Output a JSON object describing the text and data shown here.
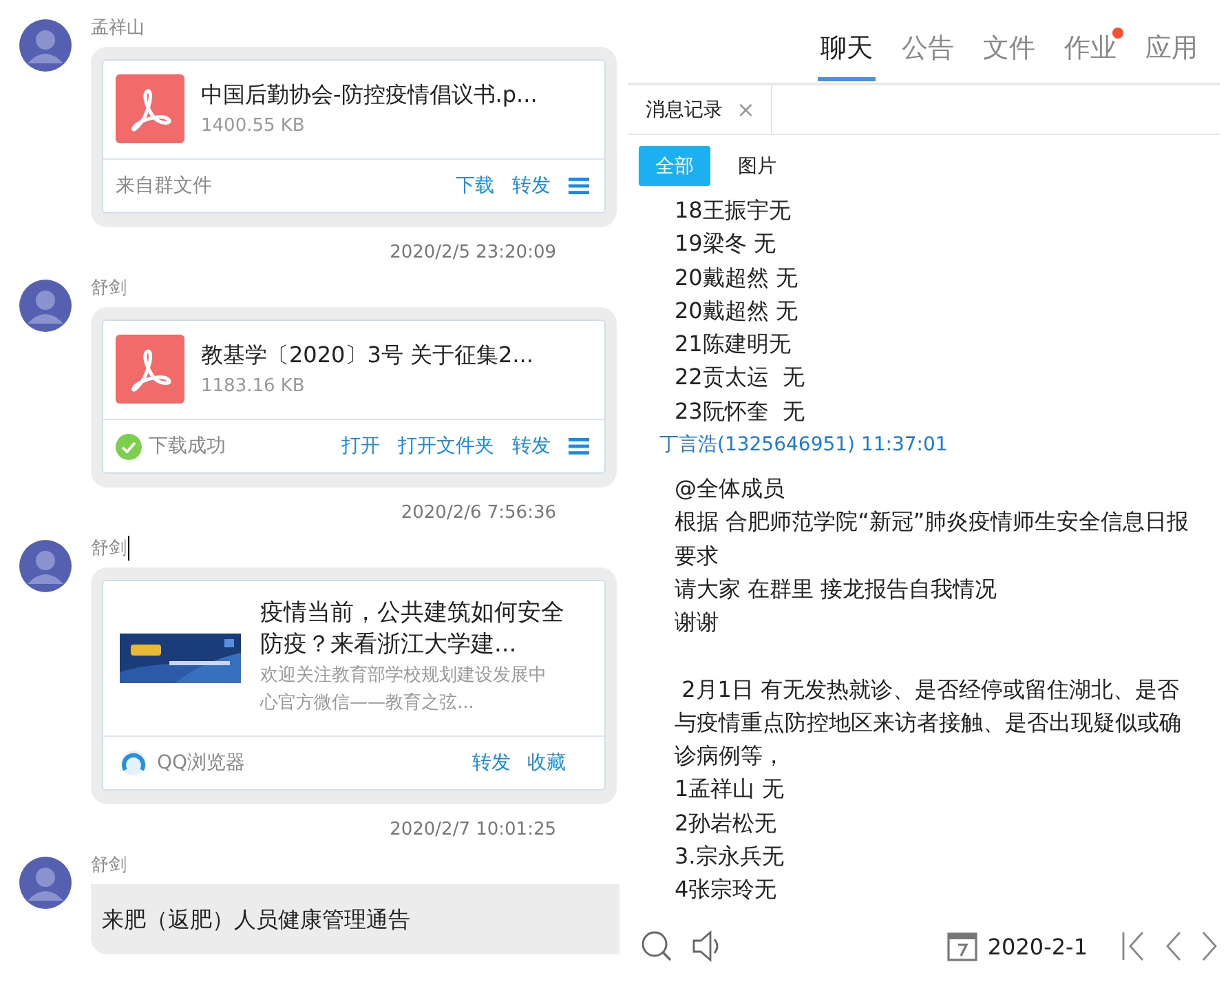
{
  "chat": {
    "feed": [
      {
        "kind": "file",
        "sender": "孟祥山",
        "caret": false,
        "file": {
          "name": "中国后勤协会-防控疫情倡议书.p...",
          "size": "1400.55 KB"
        },
        "footer": {
          "status": "来自群文件",
          "done": false,
          "actions": [
            "下载",
            "转发"
          ]
        }
      },
      {
        "kind": "time",
        "text": "2020/2/5 23:20:09"
      },
      {
        "kind": "file",
        "sender": "舒剑",
        "caret": false,
        "file": {
          "name": "教基学〔2020〕3号  关于征集2...",
          "size": "1183.16 KB"
        },
        "footer": {
          "status": "下载成功",
          "done": true,
          "actions": [
            "打开",
            "打开文件夹",
            "转发"
          ]
        }
      },
      {
        "kind": "time",
        "text": "2020/2/6 7:56:36"
      },
      {
        "kind": "link",
        "sender": "舒剑",
        "caret": true,
        "title": "疫情当前，公共建筑如何安全防疫？来看浙江大学建...",
        "summary": "欢迎关注教育部学校规划建设发展中心官方微信——教育之弦...",
        "source": "QQ浏览器",
        "actions": [
          "转发",
          "收藏"
        ]
      },
      {
        "kind": "time",
        "text": "2020/2/7 10:01:25"
      },
      {
        "kind": "text",
        "sender": "舒剑",
        "caret": false,
        "text": "来肥（返肥）人员健康管理通告"
      }
    ]
  },
  "tabs": [
    {
      "label": "聊天",
      "selected": true,
      "badge": false
    },
    {
      "label": "公告",
      "selected": false,
      "badge": false
    },
    {
      "label": "文件",
      "selected": false,
      "badge": false
    },
    {
      "label": "作业",
      "selected": false,
      "badge": true
    },
    {
      "label": "应用",
      "selected": false,
      "badge": false
    }
  ],
  "record_tab": {
    "label": "消息记录",
    "close": "×"
  },
  "filters": [
    {
      "label": "全部",
      "selected": true
    },
    {
      "label": "图片",
      "selected": false
    }
  ],
  "history": [
    {
      "kind": "line",
      "text": "18王振宇无"
    },
    {
      "kind": "line",
      "text": "19梁冬 无"
    },
    {
      "kind": "line",
      "text": "20戴超然 无"
    },
    {
      "kind": "line",
      "text": "20戴超然 无"
    },
    {
      "kind": "line",
      "text": "21陈建明无"
    },
    {
      "kind": "line",
      "text": "22贡太运  无"
    },
    {
      "kind": "line",
      "text": "23阮怀奎  无"
    },
    {
      "kind": "sender",
      "text": "丁言浩(1325646951) 11:37:01"
    },
    {
      "kind": "line",
      "text": "@全体成员"
    },
    {
      "kind": "line",
      "text": "根据 合肥师范学院“新冠”肺炎疫情师生安全信息日报要求"
    },
    {
      "kind": "line",
      "text": "请大家 在群里 接龙报告自我情况"
    },
    {
      "kind": "line",
      "text": "谢谢"
    },
    {
      "kind": "gap"
    },
    {
      "kind": "line",
      "text": " 2月1日 有无发热就诊、是否经停或留住湖北、是否与疫情重点防控地区来访者接触、是否出现疑似或确诊病例等，"
    },
    {
      "kind": "line",
      "text": "1孟祥山 无"
    },
    {
      "kind": "line",
      "text": "2孙岩松无"
    },
    {
      "kind": "line",
      "text": "3.宗永兵无"
    },
    {
      "kind": "line",
      "text": "4张宗玲无"
    }
  ],
  "toolbar": {
    "date": "2020-2-1"
  }
}
